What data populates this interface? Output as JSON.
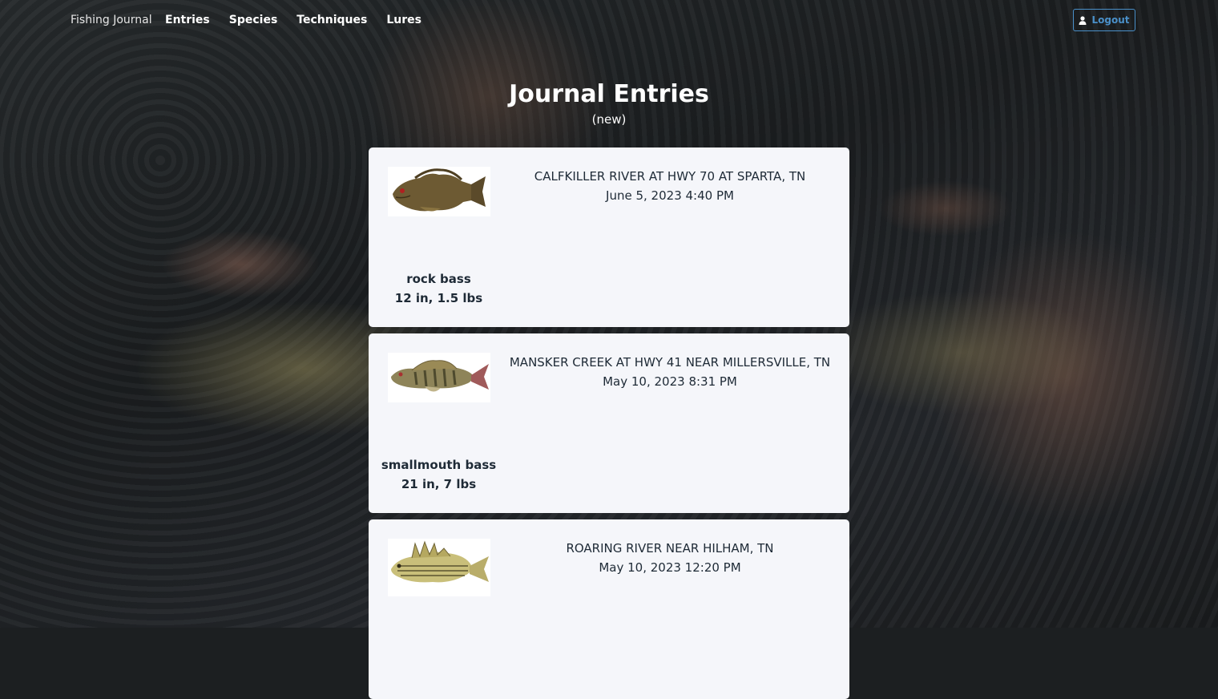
{
  "nav": {
    "brand": "Fishing Journal",
    "links": [
      "Entries",
      "Species",
      "Techniques",
      "Lures"
    ],
    "logout_label": "Logout"
  },
  "page": {
    "title": "Journal Entries",
    "new_link": "(new)"
  },
  "entries": [
    {
      "location": "CALFKILLER RIVER AT HWY 70 AT SPARTA, TN",
      "datetime": "June 5, 2023 4:40 PM",
      "species": "rock bass",
      "size": "12 in, 1.5 lbs",
      "image_icon": "rock-bass-illustration"
    },
    {
      "location": "MANSKER CREEK AT HWY 41 NEAR MILLERSVILLE, TN",
      "datetime": "May 10, 2023 8:31 PM",
      "species": "smallmouth bass",
      "size": "21 in, 7 lbs",
      "image_icon": "smallmouth-bass-illustration"
    },
    {
      "location": "ROARING RIVER NEAR HILHAM, TN",
      "datetime": "May 10, 2023 12:20 PM",
      "species": "",
      "size": "",
      "image_icon": "yellow-bass-illustration"
    }
  ],
  "colors": {
    "card_bg": "#f5f6fa",
    "card_text": "#1e2a36",
    "logout_accent": "#4a90c9"
  }
}
